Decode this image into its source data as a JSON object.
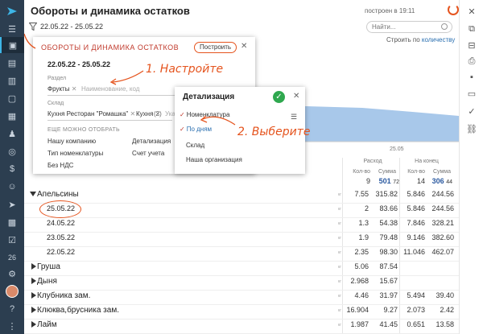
{
  "header": {
    "title": "Обороты и динамика остатков",
    "built_at": "построен в 19:11",
    "period": "22.05.22 - 25.05.22",
    "search_placeholder": "Найти...",
    "build_by_prefix": "Строить по",
    "build_by_link": "количеству"
  },
  "chart": {
    "x_label": "25.05",
    "fill_color": "#a8c8ea"
  },
  "table": {
    "col_group_expense": "Расход",
    "col_group_end": "На конец",
    "col_qty": "Кол-во",
    "col_sum": "Сумма",
    "expense_qty_total": "9",
    "expense_sum_total": "501",
    "expense_sum_total_dec": "72",
    "end_qty_total": "14",
    "end_sum_total": "306",
    "end_sum_total_dec": "44",
    "unit_kg": "кг",
    "rows": [
      {
        "name": "Апельсины",
        "r_qty": "7.55",
        "r_sum": "315.82",
        "e_qty": "5.846",
        "e_sum": "244.56"
      },
      {
        "name": "25.05.22",
        "r_qty": "2",
        "r_sum": "83.66",
        "e_qty": "5.846",
        "e_sum": "244.56"
      },
      {
        "name": "24.05.22",
        "r_qty": "1.3",
        "r_sum": "54.38",
        "e_qty": "7.846",
        "e_sum": "328.21"
      },
      {
        "name": "23.05.22",
        "r_qty": "1.9",
        "r_sum": "79.48",
        "e_qty": "9.146",
        "e_sum": "382.60"
      },
      {
        "name": "22.05.22",
        "r_qty": "2.35",
        "r_sum": "98.30",
        "e_qty": "11.046",
        "e_sum": "462.07"
      },
      {
        "name": "Груша",
        "r_qty": "5.06",
        "r_sum": "87.54",
        "e_qty": "",
        "e_sum": ""
      },
      {
        "name": "Дыня",
        "r_qty": "2.968",
        "r_sum": "15.67",
        "e_qty": "",
        "e_sum": ""
      },
      {
        "name": "Клубника зам.",
        "r_qty": "4.46",
        "r_sum": "31.97",
        "e_qty": "5.494",
        "e_sum": "39.40"
      },
      {
        "name": "Клюква,брусника зам.",
        "r_qty": "16.904",
        "r_sum": "9.27",
        "e_qty": "2.073",
        "e_sum": "2.42"
      },
      {
        "name": "Лайм",
        "r_qty": "1.987",
        "r_sum": "41.45",
        "e_qty": "0.651",
        "e_sum": "13.58"
      }
    ]
  },
  "filters": {
    "title": "ОБОРОТЫ И ДИНАМИКА ОСТАТКОВ",
    "build_button": "Построить",
    "period": "22.05.22 - 25.05.22",
    "section_label": "Раздел",
    "section_value": "Фрукты",
    "section_placeholder": "Наименование, код",
    "warehouse_label": "Склад",
    "warehouse_value_1": "Кухня Ресторан \"Ромашка\"",
    "warehouse_value_2": "Кухня",
    "warehouse_count": "(2)",
    "warehouse_placeholder": "Указ",
    "more_label": "ЕЩЕ МОЖНО ОТОБРАТЬ",
    "options": [
      "Нашу компанию",
      "Детализация",
      "Тип номенклатуры",
      "Счет учета",
      "Без НДС"
    ]
  },
  "detail": {
    "title": "Детализация",
    "options": [
      "Номенклатура",
      "По дням",
      "Склад",
      "Наша организация"
    ]
  },
  "notes": {
    "step1": "1. Настройте",
    "step2": "2. Выберите"
  },
  "sidebar": {
    "badge_count": "26"
  },
  "colors": {
    "accent": "#e5541e",
    "sidebar": "#2c3e50",
    "link": "#2a6fb0"
  }
}
